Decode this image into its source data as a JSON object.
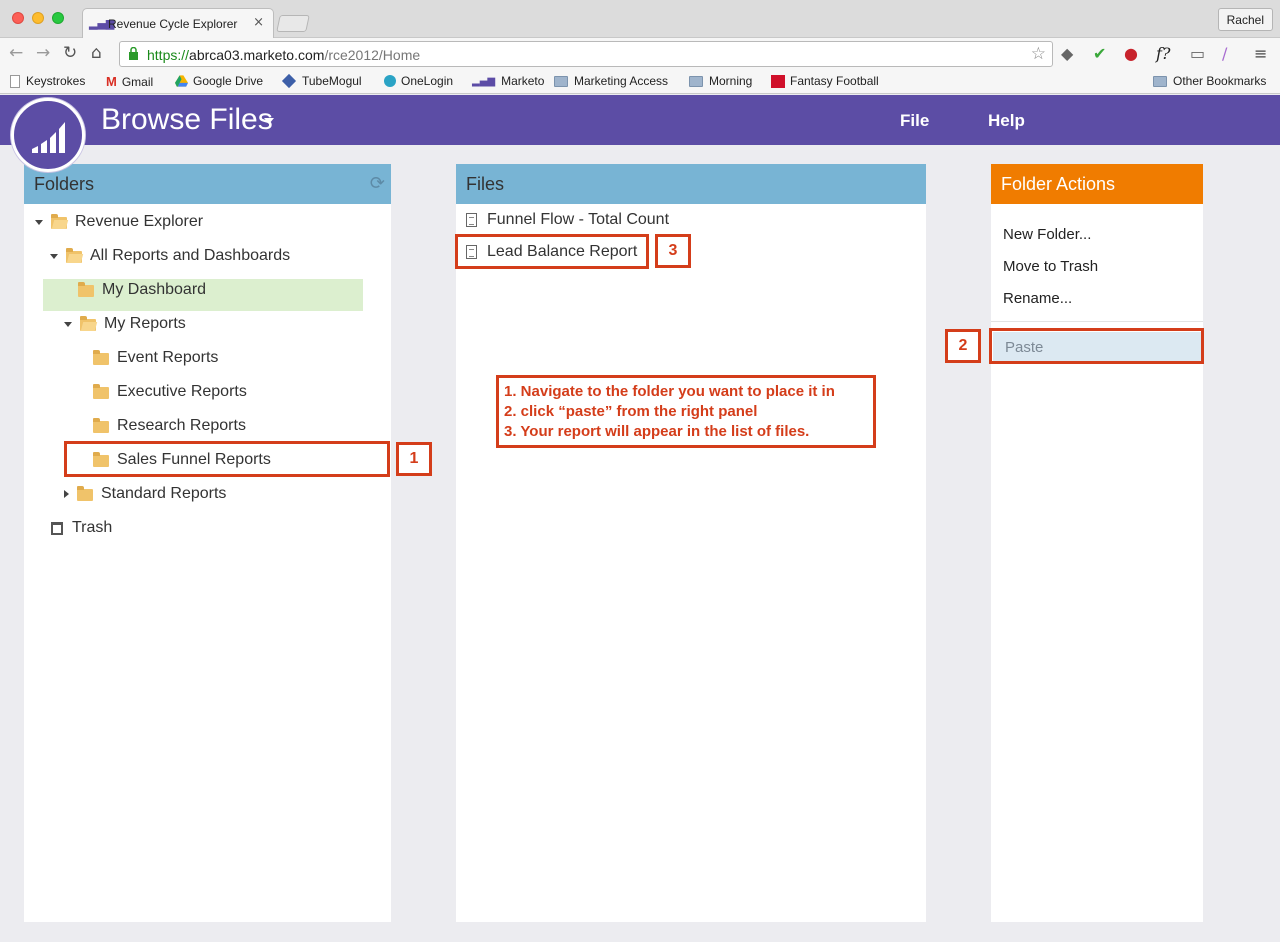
{
  "browser": {
    "tab_title": "Revenue Cycle Explorer",
    "tab_close": "×",
    "user_label": "Rachel",
    "url_protocol": "https://",
    "url_host": "abrca03.marketo.com",
    "url_path": "/rce2012/Home",
    "bookmarks": [
      {
        "label": "Keystrokes",
        "icon": "page-icon"
      },
      {
        "label": "Gmail",
        "icon": "gmail-icon"
      },
      {
        "label": "Google Drive",
        "icon": "drive-icon"
      },
      {
        "label": "TubeMogul",
        "icon": "tubemogul-icon"
      },
      {
        "label": "OneLogin",
        "icon": "onelogin-icon"
      },
      {
        "label": "Marketo",
        "icon": "marketo-icon"
      },
      {
        "label": "Marketing Access",
        "icon": "folder-icon"
      },
      {
        "label": "Morning",
        "icon": "folder-icon"
      },
      {
        "label": "Fantasy Football",
        "icon": "fantasy-icon"
      },
      {
        "label": "Other Bookmarks",
        "icon": "folder-icon"
      }
    ]
  },
  "app": {
    "title": "Browse Files",
    "menu": {
      "file": "File",
      "help": "Help"
    },
    "brand_color": "#5c4da5"
  },
  "folders": {
    "header": "Folders",
    "items": [
      {
        "label": "Revenue Explorer",
        "level": 0,
        "expanded": true,
        "icon": "folder-open-icon"
      },
      {
        "label": "All Reports and Dashboards",
        "level": 1,
        "expanded": true,
        "icon": "folder-open-icon"
      },
      {
        "label": "My Dashboard",
        "level": 2,
        "icon": "folder-icon"
      },
      {
        "label": "My Reports",
        "level": 2,
        "expanded": true,
        "icon": "folder-open-icon"
      },
      {
        "label": "Event Reports",
        "level": 3,
        "icon": "folder-icon"
      },
      {
        "label": "Executive Reports",
        "level": 3,
        "icon": "folder-icon"
      },
      {
        "label": "Research Reports",
        "level": 3,
        "icon": "folder-icon"
      },
      {
        "label": "Sales Funnel Reports",
        "level": 3,
        "selected": true,
        "icon": "folder-icon"
      },
      {
        "label": "Standard Reports",
        "level": 2,
        "expanded": false,
        "icon": "folder-icon"
      },
      {
        "label": "Trash",
        "level": 0,
        "icon": "trash-icon"
      }
    ]
  },
  "files": {
    "header": "Files",
    "items": [
      {
        "label": "Funnel Flow - Total Count",
        "icon": "document-icon"
      },
      {
        "label": "Lead Balance Report",
        "icon": "document-icon"
      }
    ]
  },
  "folder_actions": {
    "header": "Folder Actions",
    "items": [
      "New Folder...",
      "Move to Trash",
      "Rename..."
    ],
    "paste": "Paste"
  },
  "annotations": {
    "step1": "1",
    "step2": "2",
    "step3": "3",
    "instructions": [
      "1. Navigate to the folder you want to place it in",
      "2. click “paste” from the right panel",
      "3. Your report will appear in the list of files."
    ],
    "color": "#d43d1a"
  }
}
